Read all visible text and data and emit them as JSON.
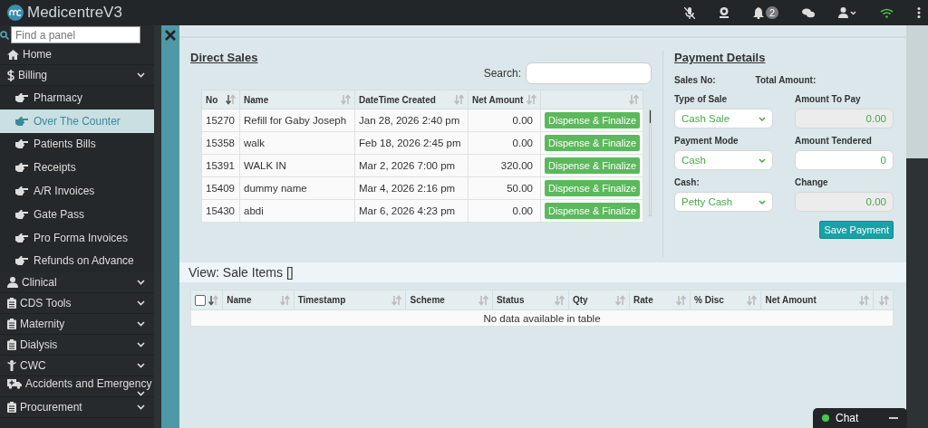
{
  "app": {
    "title": "MedicentreV3"
  },
  "topbar": {
    "notification_count": "2"
  },
  "sidebar": {
    "search_placeholder": "Find a panel",
    "items": [
      {
        "label": "Home",
        "kind": "link",
        "selected": false
      },
      {
        "label": "Billing",
        "kind": "group",
        "selected": false,
        "expanded": true,
        "children": [
          {
            "label": "Pharmacy",
            "selected": false
          },
          {
            "label": "Over The Counter",
            "selected": true
          },
          {
            "label": "Patients Bills",
            "selected": false
          },
          {
            "label": "Receipts",
            "selected": false
          },
          {
            "label": "A/R Invoices",
            "selected": false
          },
          {
            "label": "Gate Pass",
            "selected": false
          },
          {
            "label": "Pro Forma Invoices",
            "selected": false
          },
          {
            "label": "Refunds on Advance",
            "selected": false
          }
        ]
      },
      {
        "label": "Clinical",
        "kind": "group",
        "selected": false
      },
      {
        "label": "CDS Tools",
        "kind": "group",
        "selected": false
      },
      {
        "label": "Maternity",
        "kind": "group",
        "selected": false
      },
      {
        "label": "Dialysis",
        "kind": "group",
        "selected": false
      },
      {
        "label": "CWC",
        "kind": "group",
        "selected": false
      },
      {
        "label": "Accidents and Emergency",
        "kind": "group",
        "selected": false
      },
      {
        "label": "Procurement",
        "kind": "group",
        "selected": false
      }
    ]
  },
  "direct_sales": {
    "title": "Direct Sales",
    "search_label": "Search:",
    "columns": [
      {
        "label": "No",
        "sorted": true
      },
      {
        "label": "Name",
        "sorted": false
      },
      {
        "label": "DateTime Created",
        "sorted": false
      },
      {
        "label": "Net Amount",
        "sorted": false
      },
      {
        "sorted": false
      }
    ],
    "rows": [
      {
        "no": "15270",
        "name": "Refill for Gaby Joseph",
        "created": "Jan 28, 2026 2:40 pm",
        "net_amount": "0.00",
        "action": "Dispense & Finalize"
      },
      {
        "no": "15358",
        "name": "walk",
        "created": "Feb 18, 2026 2:45 pm",
        "net_amount": "0.00",
        "action": "Dispense & Finalize"
      },
      {
        "no": "15391",
        "name": "WALK IN",
        "created": "Mar 2, 2026 7:00 pm",
        "net_amount": "320.00",
        "action": "Dispense & Finalize"
      },
      {
        "no": "15409",
        "name": "dummy name",
        "created": "Mar 4, 2026 2:16 pm",
        "net_amount": "50.00",
        "action": "Dispense & Finalize"
      },
      {
        "no": "15430",
        "name": "abdi",
        "created": "Mar 6, 2026 4:23 pm",
        "net_amount": "0.00",
        "action": "Dispense & Finalize"
      }
    ]
  },
  "payment": {
    "title": "Payment Details",
    "sales_no_label": "Sales No:",
    "total_label": "Total Amount:",
    "fields": [
      {
        "label": "Type of Sale",
        "kind": "select",
        "value": "Cash Sale",
        "readonly": false
      },
      {
        "label": "Amount To Pay",
        "kind": "input",
        "value": "0.00",
        "readonly": true
      },
      {
        "label": "Payment Mode",
        "kind": "select",
        "value": "Cash",
        "readonly": false
      },
      {
        "label": "Amount Tendered",
        "kind": "input",
        "value": "0",
        "readonly": false
      },
      {
        "label": "Cash:",
        "kind": "select",
        "value": "Petty Cash",
        "readonly": false
      },
      {
        "label": "Change",
        "kind": "input",
        "value": "0.00",
        "readonly": true
      }
    ],
    "save_button": "Save Payment"
  },
  "sale_items": {
    "title": "View: Sale Items []",
    "select_all_checked": false,
    "columns": [
      "Name",
      "Timestamp",
      "Scheme",
      "Status",
      "Qty",
      "Rate",
      "% Disc",
      "Net Amount",
      ""
    ],
    "empty_message": "No data available in table"
  },
  "chat": {
    "label": "Chat",
    "online": true
  }
}
